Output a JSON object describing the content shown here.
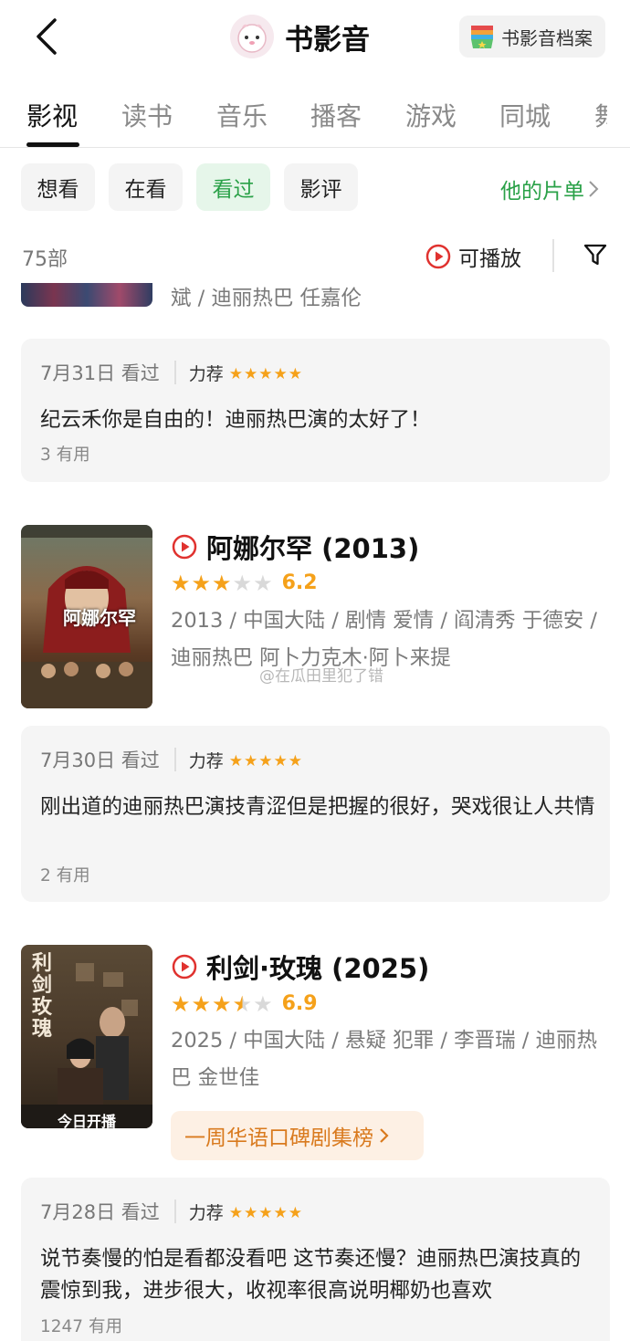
{
  "header": {
    "title": "书影音",
    "archive_label": "书影音档案"
  },
  "tabs": [
    {
      "label": "影视"
    },
    {
      "label": "读书"
    },
    {
      "label": "音乐"
    },
    {
      "label": "播客"
    },
    {
      "label": "游戏"
    },
    {
      "label": "同城"
    },
    {
      "label": "舞"
    }
  ],
  "chips": [
    {
      "label": "想看"
    },
    {
      "label": "在看"
    },
    {
      "label": "看过"
    },
    {
      "label": "影评"
    }
  ],
  "his_list": {
    "label": "他的片单"
  },
  "summary": {
    "count": "75部",
    "playable": "可播放"
  },
  "partial_meta": "斌 / 迪丽热巴 任嘉伦",
  "reviews": [
    {
      "date": "7月31日 看过",
      "rec": "力荐",
      "rating": 5,
      "text": "纪云禾你是自由的！迪丽热巴演的太好了！",
      "useful": "3 有用"
    },
    {
      "date": "7月30日 看过",
      "rec": "力荐",
      "rating": 5,
      "text": "刚出道的迪丽热巴演技青涩但是把握的很好，哭戏很让人共情",
      "useful": "2 有用"
    },
    {
      "date": "7月28日 看过",
      "rec": "力荐",
      "rating": 5,
      "text": "说节奏慢的怕是看都没看吧 这节奏还慢？迪丽热巴演技真的震惊到我，进步很大，收视率很高说明椰奶也喜欢",
      "useful": "1247 有用"
    }
  ],
  "movies": [
    {
      "title": "阿娜尔罕 (2013)",
      "stars": 3,
      "score": "6.2",
      "meta": "2013 / 中国大陆 / 剧情 爱情 / 阎清秀 于德安 / 迪丽热巴 阿卜力克木·阿卜来提",
      "poster_text": "阿娜尔罕"
    },
    {
      "title": "利剑·玫瑰 (2025)",
      "stars": 3.5,
      "score": "6.9",
      "meta": "2025 / 中国大陆 / 悬疑 犯罪 / 李晋瑞 / 迪丽热巴 金世佳",
      "poster_text": "利剑玫瑰",
      "poster_banner": "今日开播",
      "rank_badge": "一周华语口碑剧集榜"
    }
  ],
  "watermark": "@在瓜田里犯了错",
  "colors": {
    "green": "#2aa148",
    "star": "#f5a11a",
    "play_red": "#e0322f",
    "badge_orange": "#d97a1e"
  }
}
